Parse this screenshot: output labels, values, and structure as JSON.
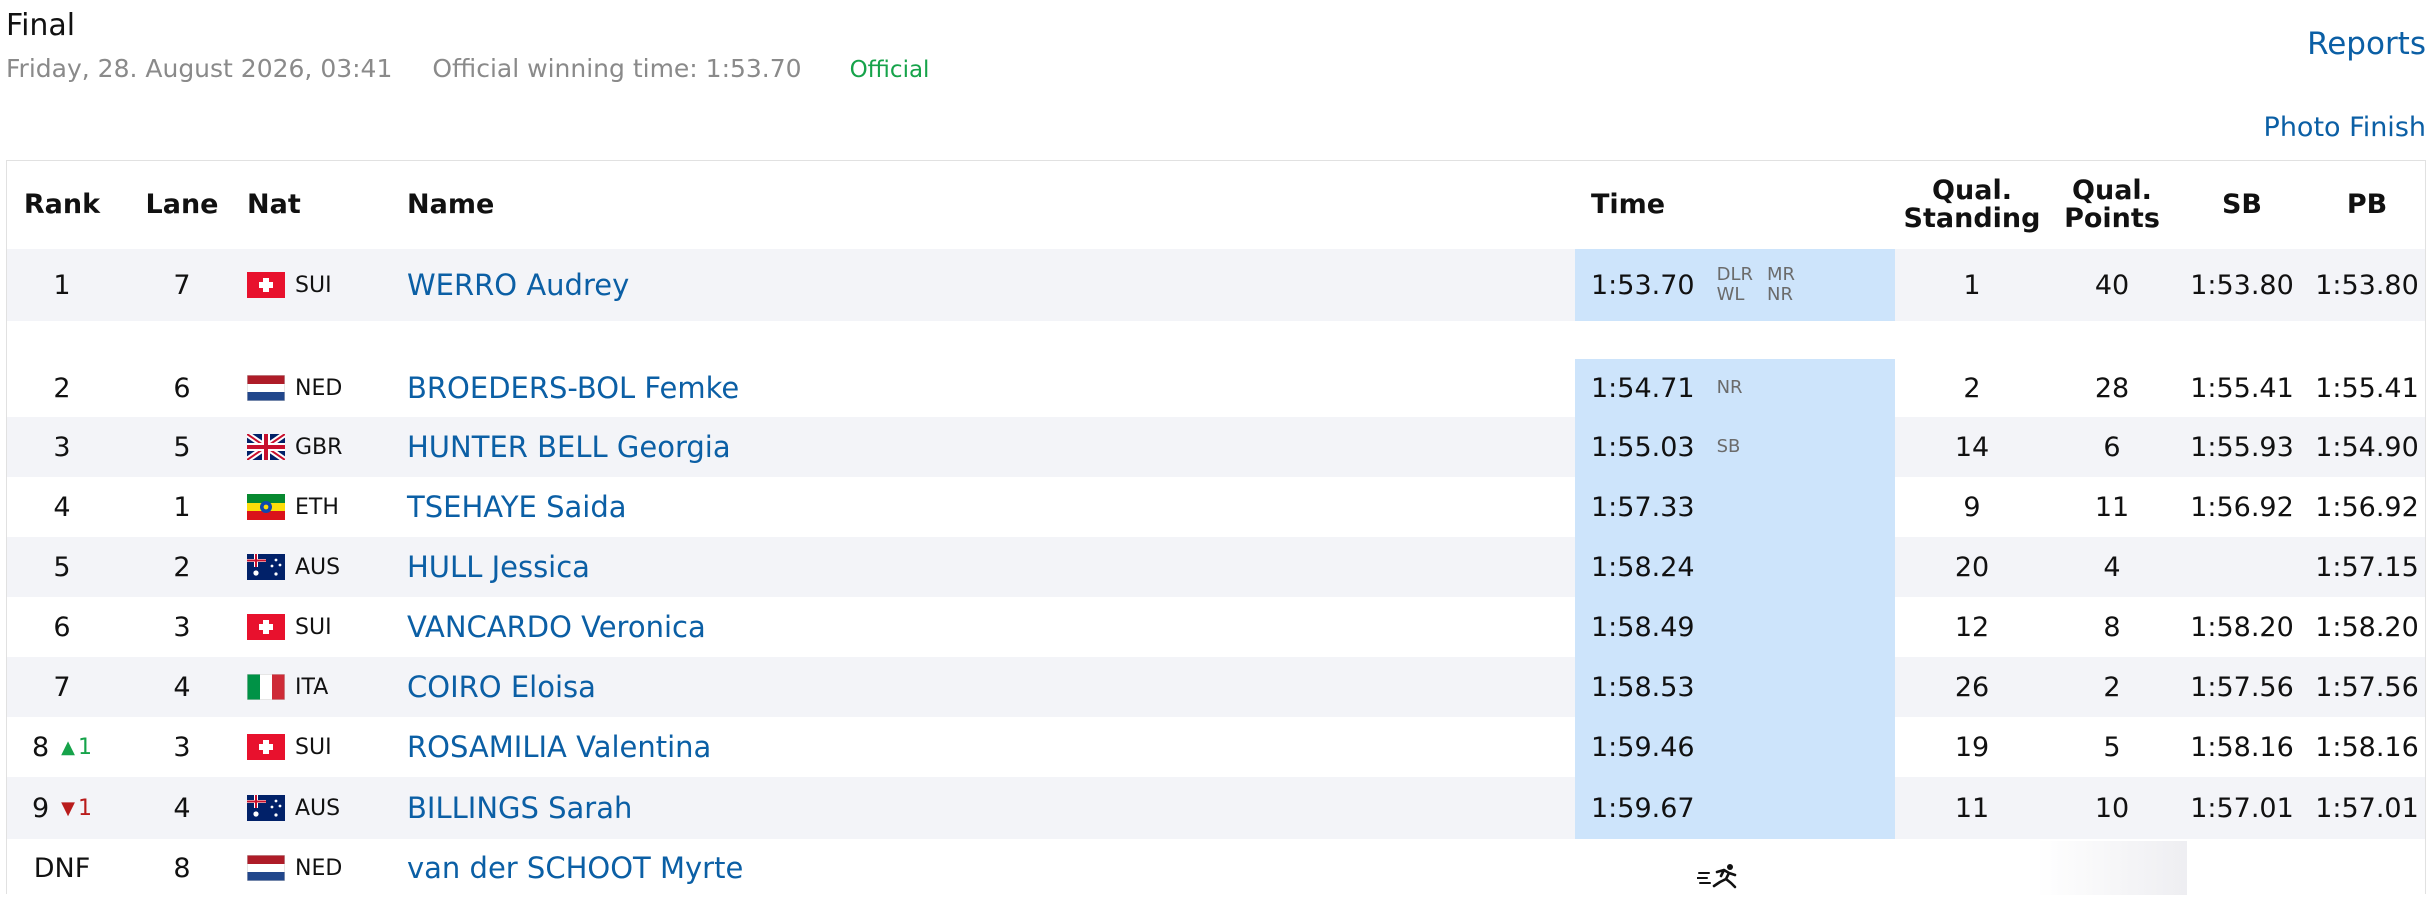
{
  "header": {
    "title": "Final",
    "date": "Friday, 28. August 2026, 03:41",
    "winning_time": "Official winning time: 1:53.70",
    "status": "Official"
  },
  "links": {
    "reports": "Reports",
    "photo_finish": "Photo Finish"
  },
  "columns": {
    "rank": "Rank",
    "lane": "Lane",
    "nat": "Nat",
    "name": "Name",
    "time": "Time",
    "qual_standing": "Qual.\nStanding",
    "qual_points": "Qual.\nPoints",
    "sb": "SB",
    "pb": "PB"
  },
  "colors": {
    "link": "#0b5fa5",
    "time_highlight": "#cde4fb",
    "up": "#16a34a",
    "down": "#b91c1c",
    "official": "#16a34a"
  },
  "rows": [
    {
      "rank": "1",
      "change": null,
      "lane": "7",
      "nat": "SUI",
      "name": "WERRO Audrey",
      "time": "1:53.70",
      "records": [
        "DLR",
        "MR",
        "WL",
        "NR"
      ],
      "qual_standing": "1",
      "qual_points": "40",
      "sb": "1:53.80",
      "pb": "1:53.80"
    },
    {
      "rank": "2",
      "change": null,
      "lane": "6",
      "nat": "NED",
      "name": "BROEDERS-BOL Femke",
      "time": "1:54.71",
      "records": [
        "NR"
      ],
      "qual_standing": "2",
      "qual_points": "28",
      "sb": "1:55.41",
      "pb": "1:55.41"
    },
    {
      "rank": "3",
      "change": null,
      "lane": "5",
      "nat": "GBR",
      "name": "HUNTER BELL Georgia",
      "time": "1:55.03",
      "records": [
        "SB"
      ],
      "qual_standing": "14",
      "qual_points": "6",
      "sb": "1:55.93",
      "pb": "1:54.90"
    },
    {
      "rank": "4",
      "change": null,
      "lane": "1",
      "nat": "ETH",
      "name": "TSEHAYE Saida",
      "time": "1:57.33",
      "records": [],
      "qual_standing": "9",
      "qual_points": "11",
      "sb": "1:56.92",
      "pb": "1:56.92"
    },
    {
      "rank": "5",
      "change": null,
      "lane": "2",
      "nat": "AUS",
      "name": "HULL Jessica",
      "time": "1:58.24",
      "records": [],
      "qual_standing": "20",
      "qual_points": "4",
      "sb": "",
      "pb": "1:57.15"
    },
    {
      "rank": "6",
      "change": null,
      "lane": "3",
      "nat": "SUI",
      "name": "VANCARDO Veronica",
      "time": "1:58.49",
      "records": [],
      "qual_standing": "12",
      "qual_points": "8",
      "sb": "1:58.20",
      "pb": "1:58.20"
    },
    {
      "rank": "7",
      "change": null,
      "lane": "4",
      "nat": "ITA",
      "name": "COIRO Eloisa",
      "time": "1:58.53",
      "records": [],
      "qual_standing": "26",
      "qual_points": "2",
      "sb": "1:57.56",
      "pb": "1:57.56"
    },
    {
      "rank": "8",
      "change": {
        "dir": "up",
        "value": "1"
      },
      "lane": "3",
      "nat": "SUI",
      "name": "ROSAMILIA Valentina",
      "time": "1:59.46",
      "records": [],
      "qual_standing": "19",
      "qual_points": "5",
      "sb": "1:58.16",
      "pb": "1:58.16"
    },
    {
      "rank": "9",
      "change": {
        "dir": "down",
        "value": "1"
      },
      "lane": "4",
      "nat": "AUS",
      "name": "BILLINGS Sarah",
      "time": "1:59.67",
      "records": [],
      "qual_standing": "11",
      "qual_points": "10",
      "sb": "1:57.01",
      "pb": "1:57.01"
    },
    {
      "rank": "DNF",
      "change": null,
      "lane": "8",
      "nat": "NED",
      "name": "van der SCHOOT Myrte",
      "time": "",
      "records": [],
      "qual_standing": "",
      "qual_points": "",
      "sb": "",
      "pb": "",
      "icon": "runner-icon"
    }
  ]
}
